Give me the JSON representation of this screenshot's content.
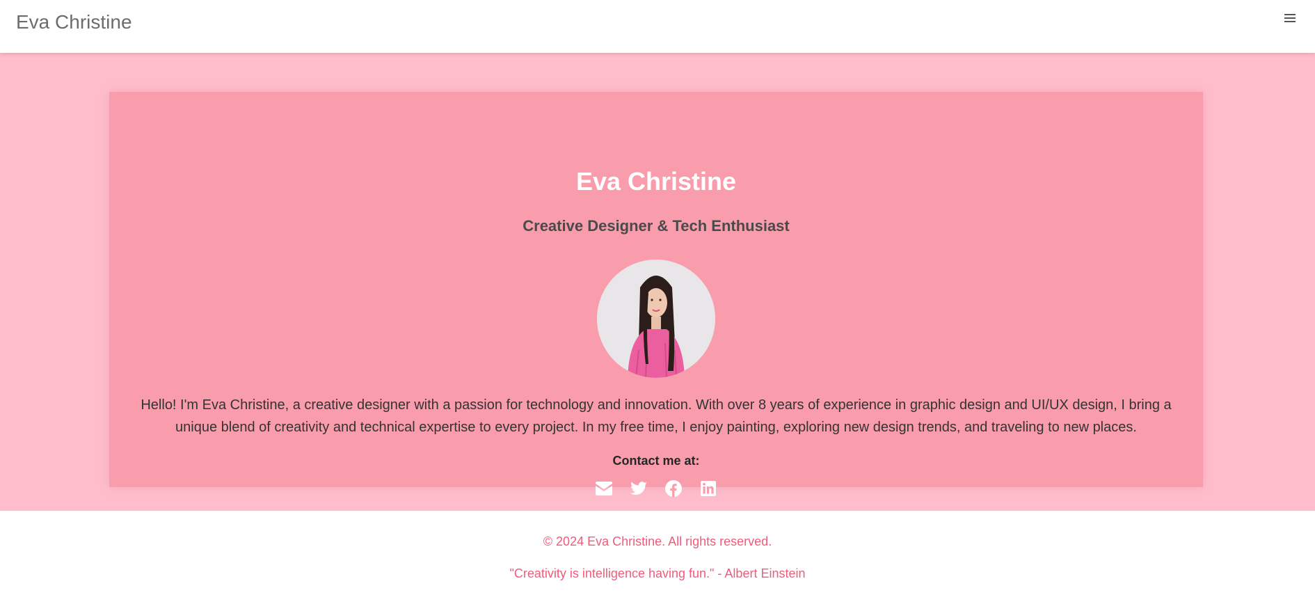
{
  "header": {
    "brand": "Eva Christine",
    "menu_icon": "hamburger-menu-icon"
  },
  "profile": {
    "name": "Eva Christine",
    "tagline": "Creative Designer & Tech Enthusiast",
    "photo_alt": "Portrait of Eva Christine",
    "bio": "Hello! I'm Eva Christine, a creative designer with a passion for technology and innovation. With over 8 years of experience in graphic design and UI/UX design, I bring a unique blend of creativity and technical expertise to every project. In my free time, I enjoy painting, exploring new design trends, and traveling to new places.",
    "contact_label": "Contact me at:",
    "socials": [
      {
        "icon": "envelope-icon"
      },
      {
        "icon": "twitter-icon"
      },
      {
        "icon": "facebook-icon"
      },
      {
        "icon": "linkedin-icon"
      }
    ]
  },
  "footer": {
    "copyright": "© 2024 Eva Christine. All rights reserved.",
    "quote": "\"Creativity is intelligence having fun.\" - Albert Einstein"
  },
  "colors": {
    "page_background": "#ffbdcb",
    "card_background": "#f99dac",
    "footer_text": "#ef5b7a",
    "brand_text": "#6c6c6c"
  }
}
